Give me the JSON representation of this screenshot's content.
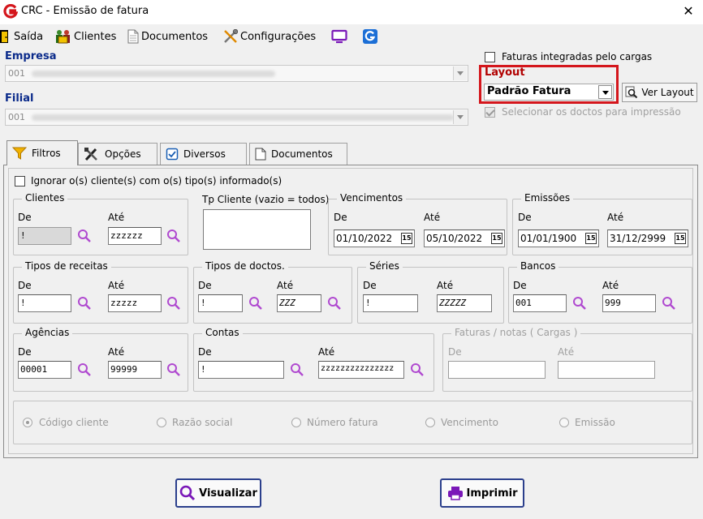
{
  "window": {
    "title": "CRC - Emissão de fatura",
    "close_glyph": "✕",
    "accent_red": "#d4161c",
    "label_blue": "#0a2a8a",
    "label_red": "#b10000"
  },
  "toolbar": {
    "saida": "Saída",
    "clientes": "Clientes",
    "documentos": "Documentos",
    "configuracoes": "Configurações"
  },
  "empresa": {
    "label": "Empresa",
    "code": "001"
  },
  "filial": {
    "label": "Filial",
    "code": "001"
  },
  "integradas": {
    "label": "Faturas integradas pelo cargas",
    "checked": false
  },
  "layout": {
    "label": "Layout",
    "value": "Padrão Fatura",
    "button": "Ver Layout"
  },
  "selecionar": {
    "label": "Selecionar os doctos para impressão",
    "checked": true,
    "enabled": false
  },
  "tabs": [
    {
      "label": "Filtros",
      "icon": "funnel-icon"
    },
    {
      "label": "Opções",
      "icon": "tools-icon"
    },
    {
      "label": "Diversos",
      "icon": "checkbox-icon"
    },
    {
      "label": "Documentos",
      "icon": "document-icon"
    }
  ],
  "ignorar": {
    "label": "Ignorar o(s) cliente(s) com o(s) tipo(s) informado(s)",
    "checked": false
  },
  "common": {
    "de": "De",
    "ate": "Até"
  },
  "clientes": {
    "title": "Clientes",
    "de": "!",
    "ate": "zzzzzz"
  },
  "tipo_cliente": {
    "title": "Tp Cliente (vazio = todos)",
    "value": ""
  },
  "vencimentos": {
    "title": "Vencimentos",
    "de": "01/10/2022",
    "ate": "05/10/2022"
  },
  "emissoes": {
    "title": "Emissões",
    "de": "01/01/1900",
    "ate": "31/12/2999"
  },
  "tipos_receitas": {
    "title": "Tipos de receitas",
    "de": "!",
    "ate": "zzzzz"
  },
  "tipos_doctos": {
    "title": "Tipos de doctos.",
    "de": "!",
    "ate": "ZZZ"
  },
  "series": {
    "title": "Séries",
    "de": "!",
    "ate": "ZZZZZ"
  },
  "bancos": {
    "title": "Bancos",
    "de": "001",
    "ate": "999"
  },
  "agencias": {
    "title": "Agências",
    "de": "00001",
    "ate": "99999"
  },
  "contas": {
    "title": "Contas",
    "de": "!",
    "ate": "zzzzzzzzzzzzzzz"
  },
  "faturas_cargas": {
    "title": "Faturas / notas ( Cargas )",
    "de": "",
    "ate": ""
  },
  "ordenacao": {
    "options": [
      "Código cliente",
      "Razão social",
      "Número fatura",
      "Vencimento",
      "Emissão"
    ],
    "selected": "Código cliente"
  },
  "buttons": {
    "visualizar": "Visualizar",
    "imprimir": "Imprimir"
  }
}
